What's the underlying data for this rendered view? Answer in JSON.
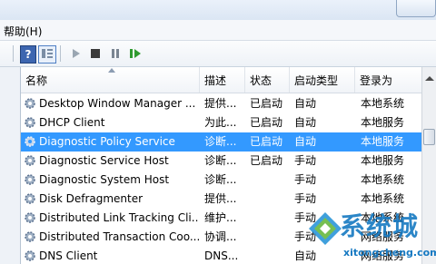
{
  "menu": {
    "help": "帮助(H)"
  },
  "toolbar": {
    "icons": [
      "help-icon",
      "view-icon",
      "play-icon",
      "stop-icon",
      "pause-icon",
      "resume-icon"
    ],
    "help_glyph": "?"
  },
  "columns": {
    "name": "名称",
    "description": "描述",
    "status": "状态",
    "startup_type": "启动类型",
    "logon_as": "登录为"
  },
  "services": [
    {
      "name": "Desktop Window Manager ...",
      "description": "提供...",
      "status": "已启动",
      "startup_type": "自动",
      "logon_as": "本地系统"
    },
    {
      "name": "DHCP Client",
      "description": "为此...",
      "status": "已启动",
      "startup_type": "自动",
      "logon_as": "本地服务"
    },
    {
      "name": "Diagnostic Policy Service",
      "description": "诊断...",
      "status": "已启动",
      "startup_type": "自动",
      "logon_as": "本地服务"
    },
    {
      "name": "Diagnostic Service Host",
      "description": "诊断...",
      "status": "已启动",
      "startup_type": "手动",
      "logon_as": "本地服务"
    },
    {
      "name": "Diagnostic System Host",
      "description": "诊断...",
      "status": "",
      "startup_type": "手动",
      "logon_as": "本地系统"
    },
    {
      "name": "Disk Defragmenter",
      "description": "提供...",
      "status": "",
      "startup_type": "手动",
      "logon_as": "本地系统"
    },
    {
      "name": "Distributed Link Tracking Cli...",
      "description": "维护...",
      "status": "",
      "startup_type": "手动",
      "logon_as": "本地系统"
    },
    {
      "name": "Distributed Transaction Coo...",
      "description": "协调...",
      "status": "",
      "startup_type": "手动",
      "logon_as": "网络服务"
    },
    {
      "name": "DNS Client",
      "description": "DNS...",
      "status": "",
      "startup_type": "自动",
      "logon_as": "网络服务"
    }
  ],
  "selected_row": 2,
  "watermark": {
    "brand": "系统城",
    "url": "xitongcheng.com"
  },
  "colors": {
    "selection": "#3399ff",
    "watermark": "#1679c2"
  }
}
